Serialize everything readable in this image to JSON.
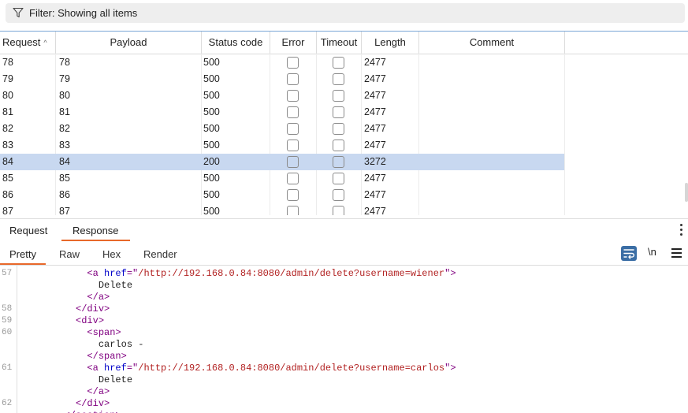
{
  "filter": {
    "label": "Filter: Showing all items"
  },
  "table": {
    "columns": [
      "Request",
      "Payload",
      "Status code",
      "Error",
      "Timeout",
      "Length",
      "Comment"
    ],
    "rows": [
      {
        "request": "78",
        "payload": "78",
        "status": "500",
        "length": "2477",
        "selected": false
      },
      {
        "request": "79",
        "payload": "79",
        "status": "500",
        "length": "2477",
        "selected": false
      },
      {
        "request": "80",
        "payload": "80",
        "status": "500",
        "length": "2477",
        "selected": false
      },
      {
        "request": "81",
        "payload": "81",
        "status": "500",
        "length": "2477",
        "selected": false
      },
      {
        "request": "82",
        "payload": "82",
        "status": "500",
        "length": "2477",
        "selected": false
      },
      {
        "request": "83",
        "payload": "83",
        "status": "500",
        "length": "2477",
        "selected": false
      },
      {
        "request": "84",
        "payload": "84",
        "status": "200",
        "length": "3272",
        "selected": true
      },
      {
        "request": "85",
        "payload": "85",
        "status": "500",
        "length": "2477",
        "selected": false
      },
      {
        "request": "86",
        "payload": "86",
        "status": "500",
        "length": "2477",
        "selected": false
      },
      {
        "request": "87",
        "payload": "87",
        "status": "500",
        "length": "2477",
        "selected": false
      }
    ]
  },
  "tabs": {
    "request": "Request",
    "response": "Response"
  },
  "subtabs": {
    "pretty": "Pretty",
    "raw": "Raw",
    "hex": "Hex",
    "render": "Render",
    "newline": "\\n"
  },
  "code": {
    "lines": [
      {
        "n": "57",
        "indent": "            ",
        "parts": [
          [
            "tag",
            "<a "
          ],
          [
            "attr",
            "href"
          ],
          [
            "tag",
            "=\""
          ],
          [
            "str",
            "/http://192.168.0.84:8080/admin/delete?username=wiener"
          ],
          [
            "tag",
            "\">"
          ]
        ]
      },
      {
        "n": "",
        "indent": "              ",
        "parts": [
          [
            "txt",
            "Delete"
          ]
        ]
      },
      {
        "n": "",
        "indent": "            ",
        "parts": [
          [
            "tag",
            "</a>"
          ]
        ]
      },
      {
        "n": "58",
        "indent": "          ",
        "parts": [
          [
            "tag",
            "</div>"
          ]
        ]
      },
      {
        "n": "59",
        "indent": "          ",
        "parts": [
          [
            "tag",
            "<div>"
          ]
        ]
      },
      {
        "n": "60",
        "indent": "            ",
        "parts": [
          [
            "tag",
            "<span>"
          ]
        ]
      },
      {
        "n": "",
        "indent": "              ",
        "parts": [
          [
            "txt",
            "carlos -"
          ]
        ]
      },
      {
        "n": "",
        "indent": "            ",
        "parts": [
          [
            "tag",
            "</span>"
          ]
        ]
      },
      {
        "n": "61",
        "indent": "            ",
        "parts": [
          [
            "tag",
            "<a "
          ],
          [
            "attr",
            "href"
          ],
          [
            "tag",
            "=\""
          ],
          [
            "str",
            "/http://192.168.0.84:8080/admin/delete?username=carlos"
          ],
          [
            "tag",
            "\">"
          ]
        ]
      },
      {
        "n": "",
        "indent": "              ",
        "parts": [
          [
            "txt",
            "Delete"
          ]
        ]
      },
      {
        "n": "",
        "indent": "            ",
        "parts": [
          [
            "tag",
            "</a>"
          ]
        ]
      },
      {
        "n": "62",
        "indent": "          ",
        "parts": [
          [
            "tag",
            "</div>"
          ]
        ]
      },
      {
        "n": "",
        "indent": "        ",
        "parts": [
          [
            "tag",
            "</section>"
          ]
        ]
      }
    ]
  },
  "colors": {
    "accent": "#e8682a",
    "selected_row": "#c8d8f0",
    "wrap_button": "#3b6ea5"
  }
}
